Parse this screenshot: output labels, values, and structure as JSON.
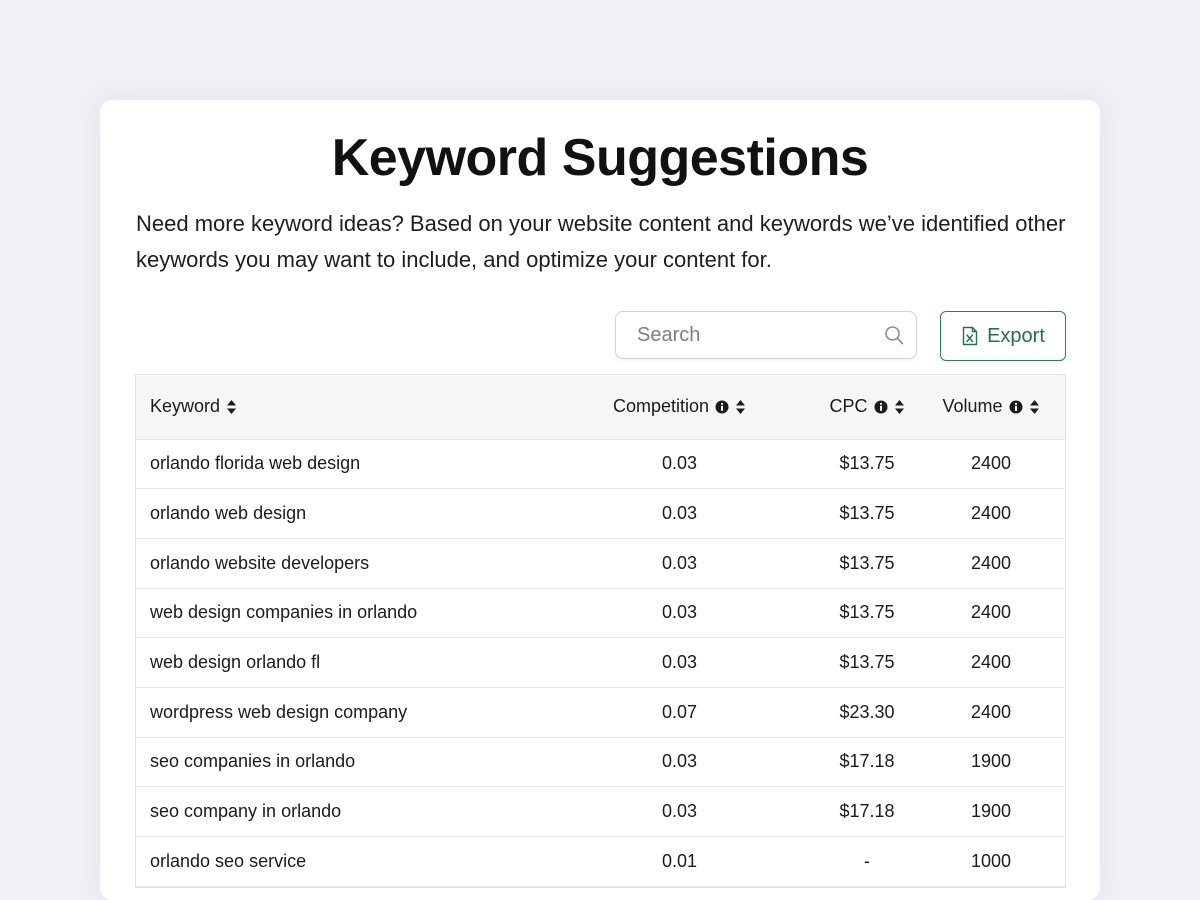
{
  "header": {
    "title": "Keyword Suggestions",
    "description": "Need more keyword ideas? Based on your website content and keywords we’ve identified other keywords you may want to include, and optimize your content for."
  },
  "toolbar": {
    "search_placeholder": "Search",
    "search_value": "",
    "export_label": "Export"
  },
  "table": {
    "columns": [
      {
        "label": "Keyword",
        "has_info": false,
        "sortable": true
      },
      {
        "label": "Competition",
        "has_info": true,
        "sortable": true
      },
      {
        "label": "CPC",
        "has_info": true,
        "sortable": true
      },
      {
        "label": "Volume",
        "has_info": true,
        "sortable": true
      }
    ],
    "rows": [
      {
        "keyword": "orlando florida web design",
        "competition": "0.03",
        "cpc": "$13.75",
        "volume": "2400"
      },
      {
        "keyword": "orlando web design",
        "competition": "0.03",
        "cpc": "$13.75",
        "volume": "2400"
      },
      {
        "keyword": "orlando website developers",
        "competition": "0.03",
        "cpc": "$13.75",
        "volume": "2400"
      },
      {
        "keyword": "web design companies in orlando",
        "competition": "0.03",
        "cpc": "$13.75",
        "volume": "2400"
      },
      {
        "keyword": "web design orlando fl",
        "competition": "0.03",
        "cpc": "$13.75",
        "volume": "2400"
      },
      {
        "keyword": "wordpress web design company",
        "competition": "0.07",
        "cpc": "$23.30",
        "volume": "2400"
      },
      {
        "keyword": "seo companies in orlando",
        "competition": "0.03",
        "cpc": "$17.18",
        "volume": "1900"
      },
      {
        "keyword": "seo company in orlando",
        "competition": "0.03",
        "cpc": "$17.18",
        "volume": "1900"
      },
      {
        "keyword": "orlando seo service",
        "competition": "0.01",
        "cpc": "-",
        "volume": "1000"
      }
    ]
  },
  "colors": {
    "page_background": "#f1f0f6",
    "export_accent": "#217346",
    "header_row_background": "#f5f6f7"
  },
  "icons": {
    "search": "search-icon",
    "export": "excel-file-icon",
    "info": "info-icon",
    "sort": "sort-icon"
  }
}
